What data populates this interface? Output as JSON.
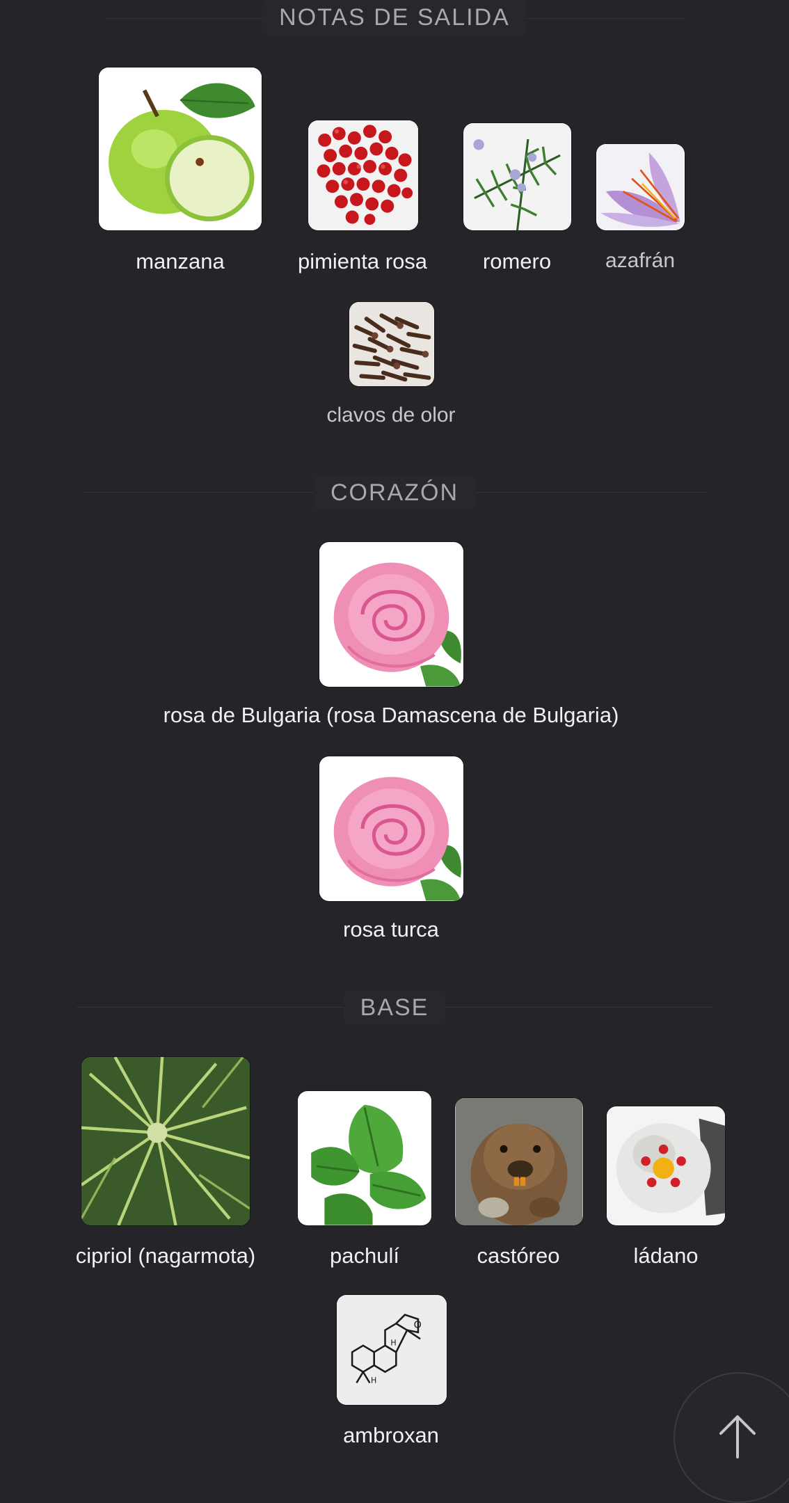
{
  "sections": {
    "top": {
      "title": "NOTAS DE SALIDA",
      "notes": [
        {
          "label": "manzana",
          "icon": "apple-image"
        },
        {
          "label": "pimienta rosa",
          "icon": "pink-pepper-image"
        },
        {
          "label": "romero",
          "icon": "rosemary-image"
        },
        {
          "label": "azafrán",
          "icon": "saffron-image"
        },
        {
          "label": "clavos de olor",
          "icon": "cloves-image"
        }
      ]
    },
    "heart": {
      "title": "CORAZÓN",
      "notes": [
        {
          "label": "rosa de Bulgaria (rosa Damascena de Bulgaria)",
          "icon": "rose-image"
        },
        {
          "label": "rosa turca",
          "icon": "rose-image"
        }
      ]
    },
    "base": {
      "title": "BASE",
      "notes": [
        {
          "label": "cipriol (nagarmota)",
          "icon": "cypriol-grass-image"
        },
        {
          "label": "pachulí",
          "icon": "patchouli-leaf-image"
        },
        {
          "label": "castóreo",
          "icon": "beaver-image"
        },
        {
          "label": "ládano",
          "icon": "cistus-flower-image"
        },
        {
          "label": "ambroxan",
          "icon": "ambroxan-molecule-image"
        }
      ]
    }
  },
  "scroll_top_button": {
    "icon": "arrow-up-icon"
  },
  "colors": {
    "background": "#252429",
    "heading": "#a9a8ae",
    "label": "#f1f0f4"
  }
}
